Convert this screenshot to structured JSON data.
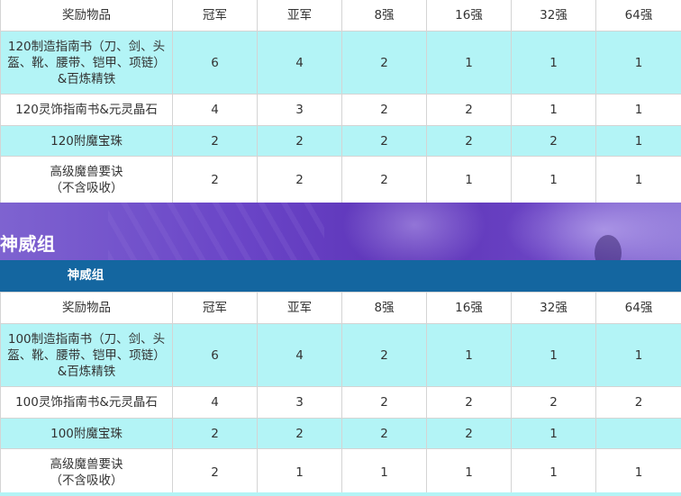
{
  "table1": {
    "headers": [
      "奖励物品",
      "冠军",
      "亚军",
      "8强",
      "16强",
      "32强",
      "64强"
    ],
    "rows": [
      {
        "name": "120制造指南书（刀、剑、头\n盔、靴、腰带、铠甲、项链）\n&百炼精铁",
        "values": [
          "6",
          "4",
          "2",
          "1",
          "1",
          "1"
        ]
      },
      {
        "name": "120灵饰指南书&元灵晶石",
        "values": [
          "4",
          "3",
          "2",
          "2",
          "1",
          "1"
        ]
      },
      {
        "name": "120附魔宝珠",
        "values": [
          "2",
          "2",
          "2",
          "2",
          "2",
          "1"
        ]
      },
      {
        "name": "高级魔兽要诀\n（不含吸收）",
        "values": [
          "2",
          "2",
          "2",
          "1",
          "1",
          "1"
        ]
      }
    ]
  },
  "section": {
    "title": "神威组"
  },
  "group_header": {
    "label": "神威组"
  },
  "table2": {
    "headers": [
      "奖励物品",
      "冠军",
      "亚军",
      "8强",
      "16强",
      "32强",
      "64强"
    ],
    "rows": [
      {
        "name": "100制造指南书（刀、剑、头\n盔、靴、腰带、铠甲、项链）\n&百炼精铁",
        "values": [
          "6",
          "4",
          "2",
          "1",
          "1",
          "1"
        ]
      },
      {
        "name": "100灵饰指南书&元灵晶石",
        "values": [
          "4",
          "3",
          "2",
          "2",
          "2",
          "2"
        ]
      },
      {
        "name": "100附魔宝珠",
        "values": [
          "2",
          "2",
          "2",
          "2",
          "1",
          ""
        ]
      },
      {
        "name": "高级魔兽要诀\n（不含吸收）",
        "values": [
          "2",
          "1",
          "1",
          "1",
          "1",
          "1"
        ]
      }
    ]
  }
}
